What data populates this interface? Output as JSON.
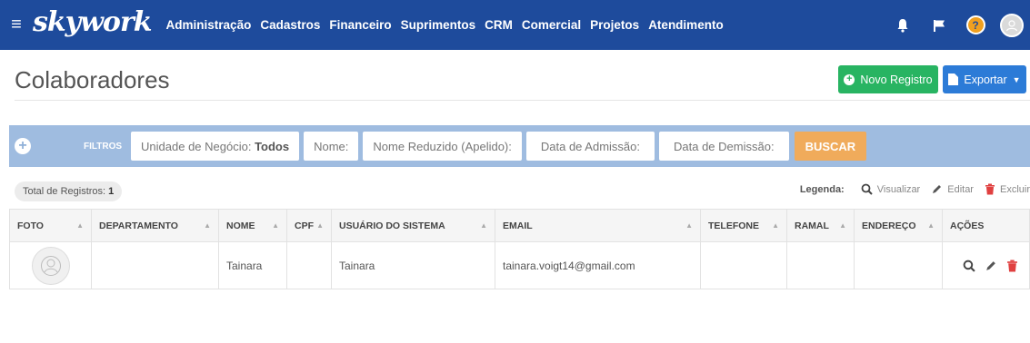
{
  "nav": {
    "logo": "skywork",
    "menu": [
      "Administração",
      "Cadastros",
      "Financeiro",
      "Suprimentos",
      "CRM",
      "Comercial",
      "Projetos",
      "Atendimento"
    ]
  },
  "header": {
    "title": "Colaboradores",
    "new_button": "Novo Registro",
    "export_button": "Exportar"
  },
  "filters": {
    "label": "FILTROS",
    "unidade_label": "Unidade de Negócio:",
    "unidade_value": "Todos",
    "nome": "Nome:",
    "nome_reduzido": "Nome Reduzido (Apelido):",
    "admissao": "Data de Admissão:",
    "demissao": "Data de Demissão:",
    "search_button": "BUSCAR"
  },
  "summary": {
    "total_label": "Total de Registros:",
    "total_value": "1"
  },
  "legend": {
    "label": "Legenda:",
    "view": "Visualizar",
    "edit": "Editar",
    "delete": "Excluir"
  },
  "table": {
    "columns": [
      "FOTO",
      "DEPARTAMENTO",
      "NOME",
      "CPF",
      "USUÁRIO DO SISTEMA",
      "EMAIL",
      "TELEFONE",
      "RAMAL",
      "ENDEREÇO",
      "AÇÕES"
    ],
    "rows": [
      {
        "departamento": "",
        "nome": "Tainara",
        "cpf": "",
        "usuario": "Tainara",
        "email": "tainara.voigt14@gmail.com",
        "telefone": "",
        "ramal": "",
        "endereco": ""
      }
    ]
  },
  "colors": {
    "nav_bg": "#1e4b9c",
    "filter_bg": "#9fbce0",
    "new_button": "#28b462",
    "export_button": "#2c7bd7",
    "search_button": "#f0ab5b",
    "delete_red": "#e04040"
  }
}
